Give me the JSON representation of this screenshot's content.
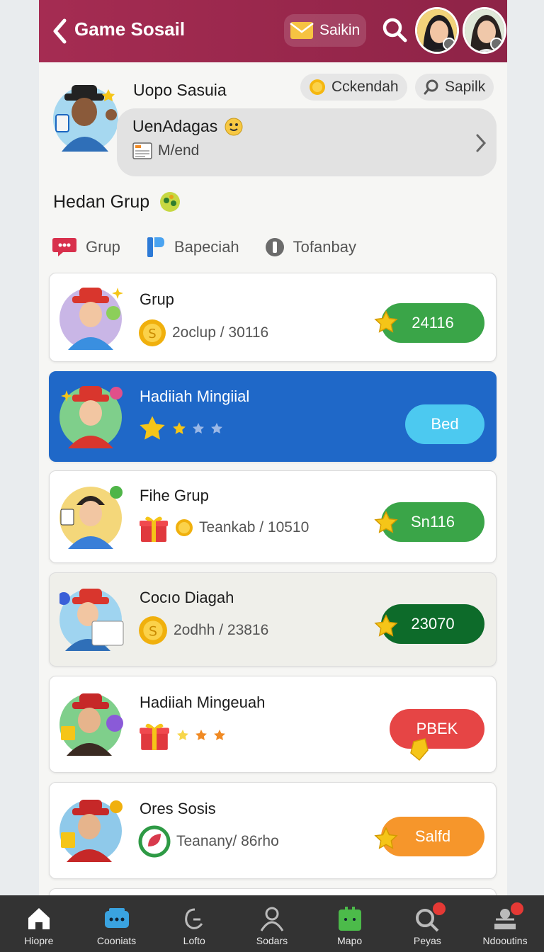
{
  "header": {
    "title": "Game Sosail",
    "mail_label": "Saikin"
  },
  "profile": {
    "name": "Uopo Sasuia",
    "pill_coins": "Cckendah",
    "pill_search": "Sapilk",
    "status_name": "UenAdagas",
    "status_sub": "M/end"
  },
  "section": {
    "title": "Hedan Grup"
  },
  "tabs": [
    {
      "label": "Grup"
    },
    {
      "label": "Bapeciah"
    },
    {
      "label": "Tofanbay"
    }
  ],
  "cards": [
    {
      "title": "Grup",
      "sub": "2oclup / 30116",
      "action": "24116"
    },
    {
      "title": "Hadiiah Mingiial",
      "action": "Bed"
    },
    {
      "title": "Fihe Grup",
      "sub": "Teankab / 10510",
      "action": "Sn116"
    },
    {
      "title": "Cocıo Diagah",
      "sub": "2odhh / 23816",
      "action": "23070"
    },
    {
      "title": "Hadiiah Mingeuah",
      "action": "PBEK"
    },
    {
      "title": "Ores Sosis",
      "sub": "Teanany/ 86rho",
      "action": "Salfd"
    }
  ],
  "nav": [
    {
      "label": "Hiopre"
    },
    {
      "label": "Cooniats"
    },
    {
      "label": "Lofto"
    },
    {
      "label": "Sodars"
    },
    {
      "label": "Mapo"
    },
    {
      "label": "Peyas"
    },
    {
      "label": "Ndooutins"
    }
  ],
  "colors": {
    "header": "#9c2a4f",
    "green": "#3aa548",
    "dark_green": "#0d6b2a",
    "blue_card": "#1f68c8",
    "cyan_button": "#4cc9f0",
    "red_button": "#e64545",
    "orange_button": "#f6962b"
  }
}
